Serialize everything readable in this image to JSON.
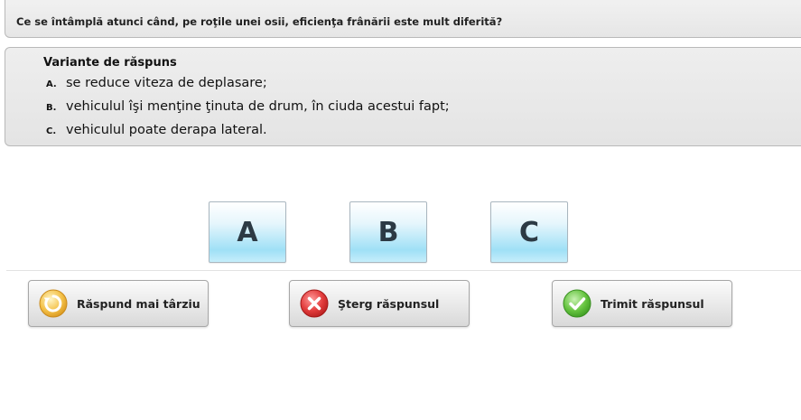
{
  "question": {
    "text": "Ce se întâmplă atunci când, pe roţile unei osii, eficienţa frânării este mult diferită?"
  },
  "answers": {
    "title": "Variante de răspuns",
    "items": [
      {
        "letter": "A.",
        "text": "se reduce viteza de deplasare;"
      },
      {
        "letter": "B.",
        "text": "vehiculul îşi menţine ţinuta de drum, în ciuda acestui fapt;"
      },
      {
        "letter": "C.",
        "text": "vehiculul poate derapa lateral."
      }
    ]
  },
  "choices": [
    "A",
    "B",
    "C"
  ],
  "actions": {
    "later": {
      "label": "Răspund mai târziu",
      "icon": "clock-arrow-icon",
      "color": "#f2b632"
    },
    "delete": {
      "label": "Şterg răspunsul",
      "icon": "close-icon",
      "color": "#e03a3a"
    },
    "send": {
      "label": "Trimit răspunsul",
      "icon": "checkmark-icon",
      "color": "#5cbf3c"
    }
  }
}
